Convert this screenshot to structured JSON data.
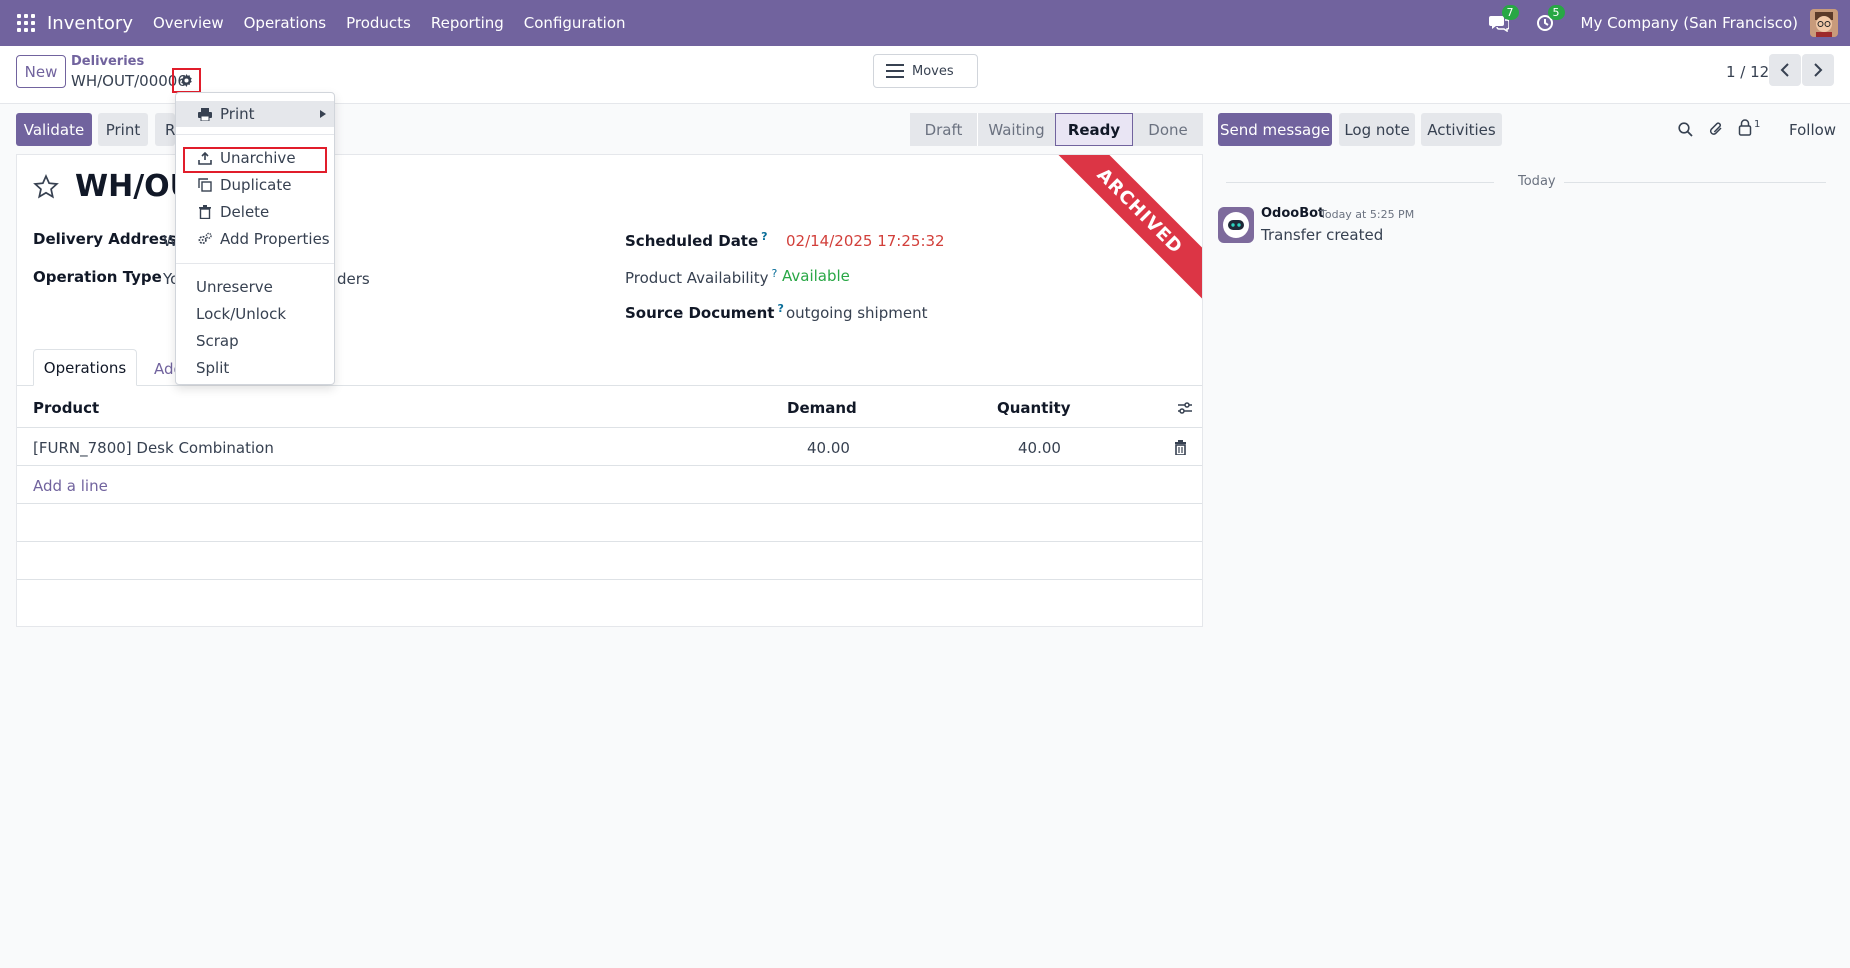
{
  "navbar": {
    "app_name": "Inventory",
    "menu": [
      "Overview",
      "Operations",
      "Products",
      "Reporting",
      "Configuration"
    ],
    "messages_count": "7",
    "activities_count": "5",
    "company": "My Company (San Francisco)"
  },
  "control_panel": {
    "new_label": "New",
    "breadcrumb_parent": "Deliveries",
    "breadcrumb_current": "WH/OUT/00006",
    "moves_label": "Moves",
    "pager": "1 / 12"
  },
  "actions": {
    "validate": "Validate",
    "print": "Print",
    "hidden_button_initial": "R"
  },
  "statusbar": {
    "stages": [
      "Draft",
      "Waiting",
      "Ready",
      "Done"
    ],
    "active": "Ready"
  },
  "form": {
    "title": "WH/OUT",
    "ribbon": "ARCHIVED",
    "delivery_address_label": "Delivery Address",
    "delivery_address_value": "W",
    "operation_type_label": "Operation Type",
    "operation_type_value_start": "Yo",
    "operation_type_value_end": "ders",
    "scheduled_date_label": "Scheduled Date",
    "scheduled_date_value": "02/14/2025 17:25:32",
    "product_availability_label": "Product Availability",
    "product_availability_value": "Available",
    "source_document_label": "Source Document",
    "source_document_value": "outgoing shipment",
    "help_mark": "?",
    "tabs": [
      "Operations",
      "Add"
    ]
  },
  "table": {
    "headers": [
      "Product",
      "Demand",
      "Quantity"
    ],
    "rows": [
      {
        "product": "[FURN_7800] Desk Combination",
        "demand": "40.00",
        "quantity": "40.00"
      }
    ],
    "add_line": "Add a line"
  },
  "chatter": {
    "send_message": "Send message",
    "log_note": "Log note",
    "activities": "Activities",
    "followers_count": "1",
    "follow": "Follow",
    "day_separator": "Today",
    "messages": [
      {
        "author": "OdooBot",
        "time": "Today at 5:25 PM",
        "body": "Transfer created"
      }
    ]
  },
  "dropdown": {
    "items": [
      "Print",
      "Unarchive",
      "Duplicate",
      "Delete",
      "Add Properties",
      "Unreserve",
      "Lock/Unlock",
      "Scrap",
      "Split"
    ]
  },
  "colors": {
    "brand": "#71639e",
    "ribbon": "#dc3545",
    "highlight": "#e11d2b",
    "success": "#28a745",
    "date_red": "#d23f3a"
  }
}
